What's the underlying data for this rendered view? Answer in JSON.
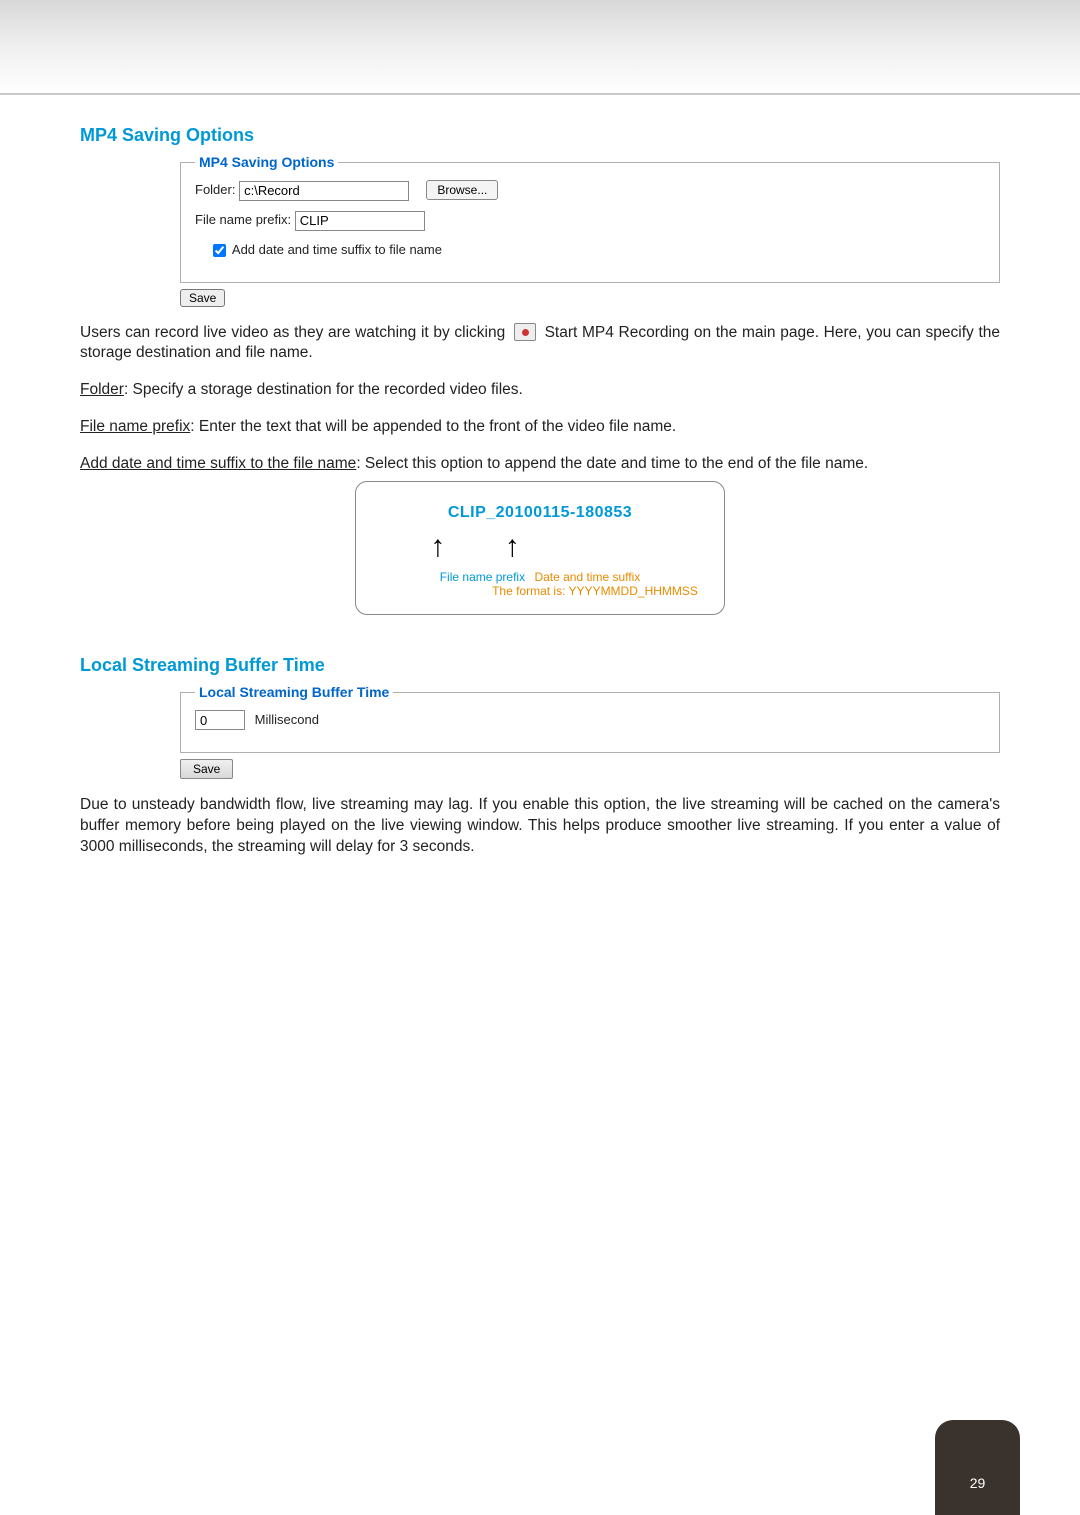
{
  "section1": {
    "heading": "MP4 Saving Options",
    "legend": "MP4 Saving Options",
    "folder_label": "Folder:",
    "folder_value": "c:\\Record",
    "browse_label": "Browse...",
    "prefix_label": "File name prefix:",
    "prefix_value": "CLIP",
    "suffix_checkbox_label": "Add date and time suffix to file name",
    "save_label": "Save"
  },
  "desc1": {
    "text_pre": "Users can record live video as they are watching it by clicking ",
    "text_post": " Start MP4 Recording on the main page. Here, you can specify the storage destination and file name."
  },
  "desc2": {
    "u": "Folder",
    "rest": ": Specify a storage destination for the recorded video files."
  },
  "desc3": {
    "u": "File name prefix",
    "rest": ": Enter the text that will be appended to the front of the video file name."
  },
  "desc4": {
    "u": "Add date and time suffix to the file name",
    "rest": ": Select this option to append the date and time to the end of the file name."
  },
  "example": {
    "filename": "CLIP_20100115-180853",
    "cap_prefix": "File name prefix",
    "cap_suffix": "Date and time suffix",
    "cap_format": "The format is: YYYYMMDD_HHMMSS"
  },
  "section2": {
    "heading": "Local Streaming Buffer Time",
    "legend": "Local Streaming Buffer Time",
    "value": "0",
    "unit": "Millisecond",
    "save_label": "Save"
  },
  "desc5": "Due to unsteady bandwidth flow, live streaming may lag. If you enable this option, the live streaming will be cached on the camera's buffer memory before being played on the live viewing window. This helps produce smoother live streaming. If you enter a value of 3000 milliseconds, the streaming will delay for 3 seconds.",
  "page_number": "29"
}
